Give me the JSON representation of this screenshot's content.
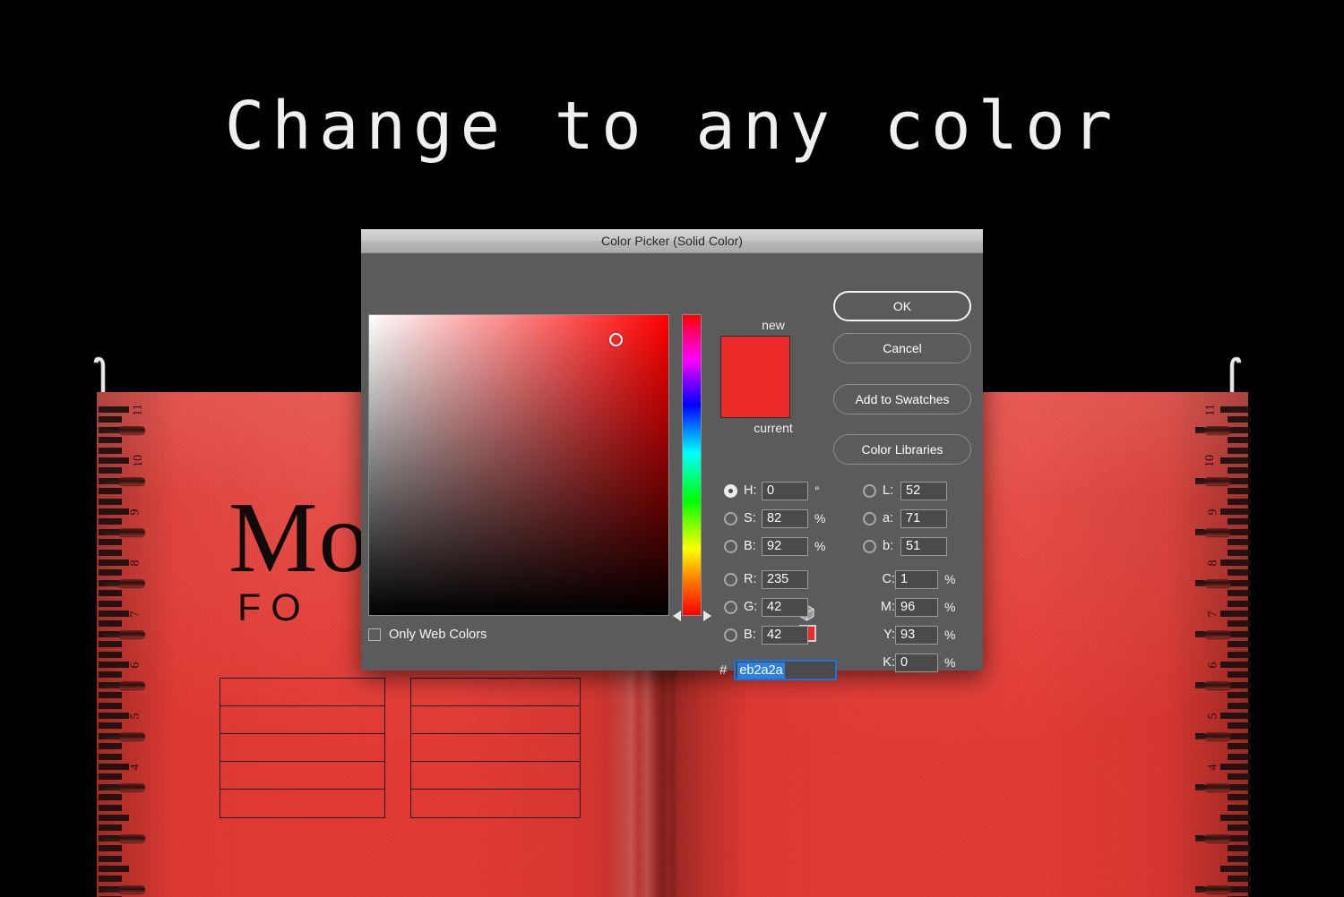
{
  "headline": {
    "text": "Change to any color"
  },
  "mockup": {
    "cover_title": "Mo",
    "cover_subtitle": "FO",
    "ruler_left_numbers": [
      "11",
      "10",
      "9",
      "8",
      "7",
      "6",
      "5",
      "4"
    ],
    "ruler_right_numbers": [
      "11",
      "10",
      "9",
      "8",
      "7",
      "6",
      "5",
      "4"
    ],
    "paper_color": "#e23a33",
    "table_a_rows": [
      "",
      "",
      "",
      "",
      ""
    ],
    "table_b_rows": [
      "",
      "",
      "",
      "",
      ""
    ]
  },
  "dialog": {
    "title": "Color Picker (Solid Color)",
    "buttons": {
      "ok": "OK",
      "cancel": "Cancel",
      "add_to_swatches": "Add to Swatches",
      "color_libraries": "Color Libraries"
    },
    "preview": {
      "new_label": "new",
      "current_label": "current",
      "new_color": "#eb2a2a",
      "current_color": "#eb2a2a",
      "alert_chip_color": "#eb2a2a"
    },
    "only_web_colors": {
      "label": "Only Web Colors",
      "checked": false
    },
    "hex": {
      "prefix": "#",
      "value": "eb2a2a",
      "selected": true
    },
    "hsb": [
      {
        "key": "H",
        "label": "H:",
        "value": "0",
        "unit": "°",
        "selected": true
      },
      {
        "key": "S",
        "label": "S:",
        "value": "82",
        "unit": "%",
        "selected": false
      },
      {
        "key": "B",
        "label": "B:",
        "value": "92",
        "unit": "%",
        "selected": false
      }
    ],
    "rgb": [
      {
        "key": "R",
        "label": "R:",
        "value": "235",
        "unit": "",
        "selected": false
      },
      {
        "key": "G",
        "label": "G:",
        "value": "42",
        "unit": "",
        "selected": false
      },
      {
        "key": "B",
        "label": "B:",
        "value": "42",
        "unit": "",
        "selected": false
      }
    ],
    "lab": [
      {
        "key": "L",
        "label": "L:",
        "value": "52",
        "unit": "",
        "selected": false
      },
      {
        "key": "a",
        "label": "a:",
        "value": "71",
        "unit": "",
        "selected": false
      },
      {
        "key": "b",
        "label": "b:",
        "value": "51",
        "unit": "",
        "selected": false
      }
    ],
    "cmyk": [
      {
        "key": "C",
        "label": "C:",
        "value": "1",
        "unit": "%"
      },
      {
        "key": "M",
        "label": "M:",
        "value": "96",
        "unit": "%"
      },
      {
        "key": "Y",
        "label": "Y:",
        "value": "93",
        "unit": "%"
      },
      {
        "key": "K",
        "label": "K:",
        "value": "0",
        "unit": "%"
      }
    ]
  }
}
